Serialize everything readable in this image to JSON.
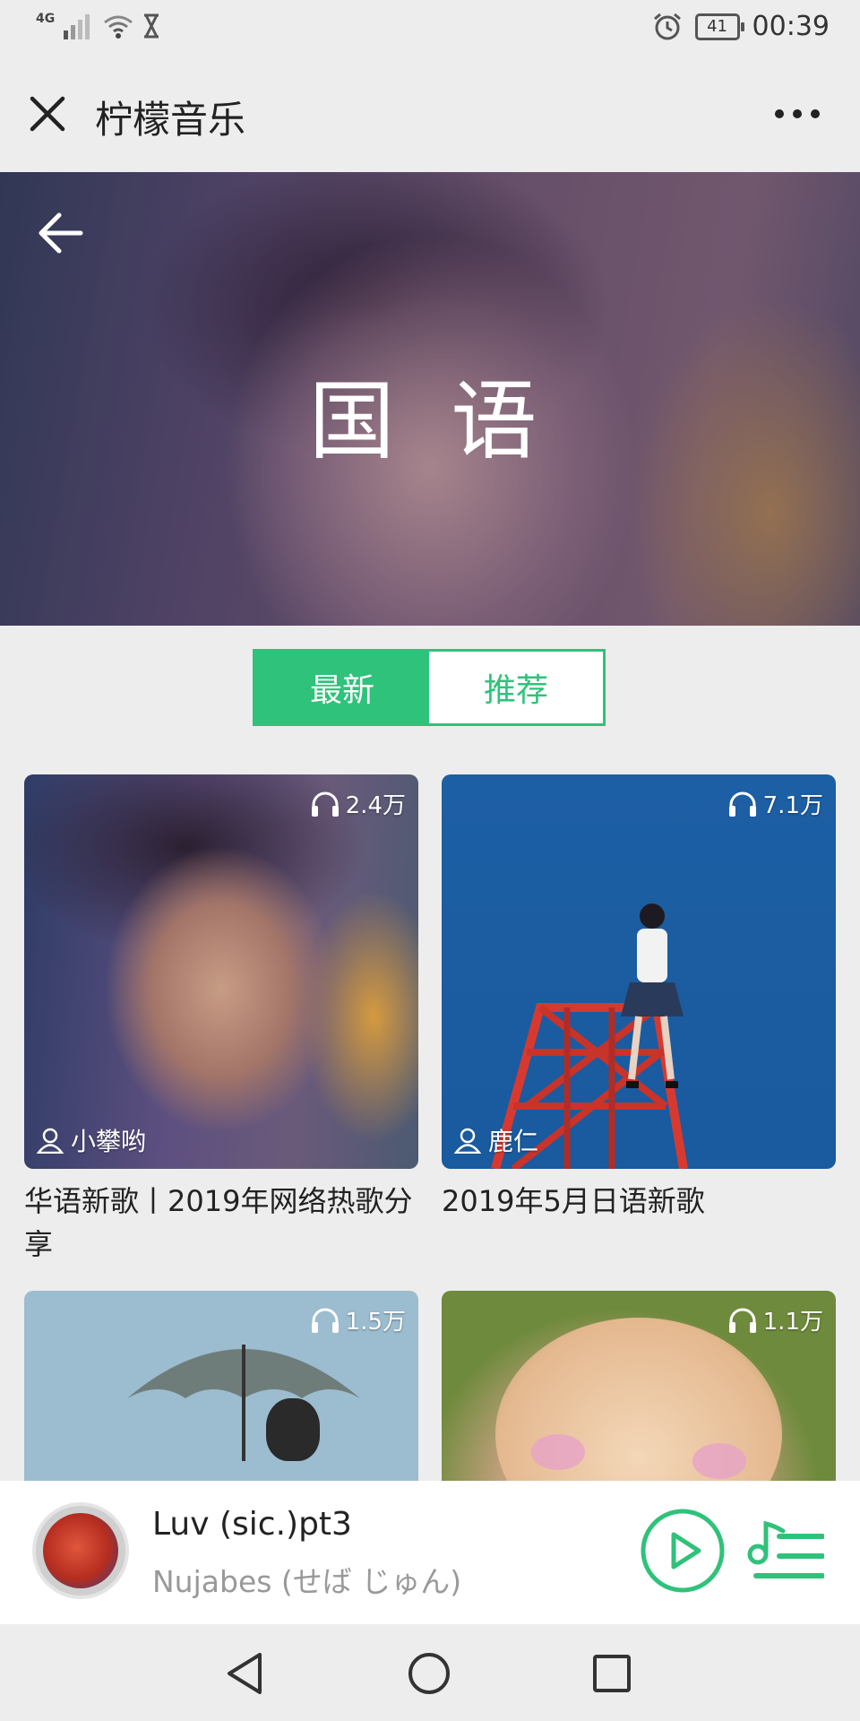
{
  "status_bar": {
    "network": "4G",
    "battery": "41",
    "time": "00:39"
  },
  "header": {
    "title": "柠檬音乐"
  },
  "hero": {
    "title": "国 语"
  },
  "tabs": [
    {
      "label": "最新",
      "active": true
    },
    {
      "label": "推荐",
      "active": false
    }
  ],
  "playlists": [
    {
      "plays": "2.4万",
      "author": "小攀哟",
      "title": "华语新歌丨2019年网络热歌分享"
    },
    {
      "plays": "7.1万",
      "author": "鹿仁",
      "title": "2019年5月日语新歌"
    },
    {
      "plays": "1.5万",
      "author": "",
      "title": ""
    },
    {
      "plays": "1.1万",
      "author": "",
      "title": ""
    }
  ],
  "now_playing": {
    "title": "Luv (sic.)pt3",
    "artist": "Nujabes (せば じゅん)"
  },
  "colors": {
    "accent": "#2fc27a",
    "background": "#ededed"
  }
}
